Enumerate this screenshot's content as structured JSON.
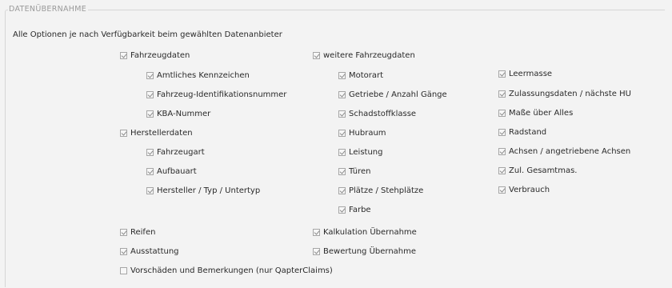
{
  "section": {
    "legend": "DATENÜBERNAHME",
    "intro": "Alle Optionen je nach Verfügbarkeit beim gewählten Datenanbieter"
  },
  "options": {
    "fahrzeugdaten": {
      "label": "Fahrzeugdaten",
      "checked": true
    },
    "amtliches_kennzeichen": {
      "label": "Amtliches Kennzeichen",
      "checked": true
    },
    "fin": {
      "label": "Fahrzeug-Identifikationsnummer",
      "checked": true
    },
    "kba_nummer": {
      "label": "KBA-Nummer",
      "checked": true
    },
    "herstellerdaten": {
      "label": "Herstellerdaten",
      "checked": true
    },
    "fahrzeugart": {
      "label": "Fahrzeugart",
      "checked": true
    },
    "aufbauart": {
      "label": "Aufbauart",
      "checked": true
    },
    "hersteller_typ": {
      "label": "Hersteller / Typ / Untertyp",
      "checked": true
    },
    "weitere_fahrzeugdaten": {
      "label": "weitere Fahrzeugdaten",
      "checked": true
    },
    "motorart": {
      "label": "Motorart",
      "checked": true
    },
    "getriebe": {
      "label": "Getriebe / Anzahl Gänge",
      "checked": true
    },
    "schadstoffklasse": {
      "label": "Schadstoffklasse",
      "checked": true
    },
    "hubraum": {
      "label": "Hubraum",
      "checked": true
    },
    "leistung": {
      "label": "Leistung",
      "checked": true
    },
    "tueren": {
      "label": "Türen",
      "checked": true
    },
    "plaetze": {
      "label": "Plätze / Stehplätze",
      "checked": true
    },
    "farbe": {
      "label": "Farbe",
      "checked": true
    },
    "leermasse": {
      "label": "Leermasse",
      "checked": true
    },
    "zulassungsdaten": {
      "label": "Zulassungsdaten / nächste HU",
      "checked": true
    },
    "masse_ueber_alles": {
      "label": "Maße über Alles",
      "checked": true
    },
    "radstand": {
      "label": "Radstand",
      "checked": true
    },
    "achsen": {
      "label": "Achsen / angetriebene Achsen",
      "checked": true
    },
    "zul_gesamtmasse": {
      "label": "Zul. Gesamtmas.",
      "checked": true
    },
    "verbrauch": {
      "label": "Verbrauch",
      "checked": true
    },
    "reifen": {
      "label": "Reifen",
      "checked": true
    },
    "ausstattung": {
      "label": "Ausstattung",
      "checked": true
    },
    "kalkulation": {
      "label": "Kalkulation Übernahme",
      "checked": true
    },
    "bewertung": {
      "label": "Bewertung Übernahme",
      "checked": true
    },
    "vorschaeden": {
      "label": "Vorschäden und Bemerkungen (nur QapterClaims)",
      "checked": false
    }
  }
}
